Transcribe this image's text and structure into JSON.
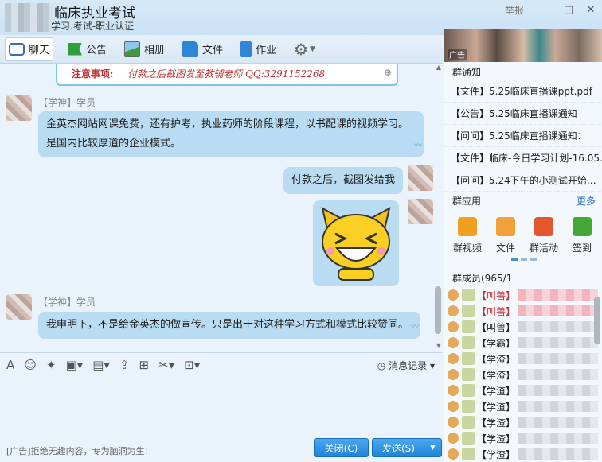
{
  "window": {
    "title": "临床执业考试",
    "subtitle": "学习.考试-职业认证",
    "report_label": "举报",
    "ctrl_min": "—",
    "ctrl_max": "□",
    "ctrl_close": "✕"
  },
  "toolbar": {
    "items": [
      {
        "label": "聊天"
      },
      {
        "label": "公告"
      },
      {
        "label": "相册"
      },
      {
        "label": "文件"
      },
      {
        "label": "作业"
      }
    ],
    "arrow": "▼"
  },
  "chat": {
    "notice_image": {
      "bold": "注意事项:",
      "text": "付款之后截图发至教辅老师 QQ:3291152268"
    },
    "messages": [
      {
        "sender": "【学神】学员",
        "line1": "金英杰网站网课免费，还有护考，执业药师的阶段课程，以书配课的视频学习。",
        "line2": "是国内比较厚道的企业模式。"
      },
      {
        "text": "付款之后，截图发给我"
      },
      {
        "sender": "【学神】学员",
        "text": "我申明下，不是给金英杰的做宣传。只是出于对这种学习方式和模式比较赞同。"
      }
    ]
  },
  "inputbar": {
    "history_label": "消息记录"
  },
  "footer": {
    "ad_text": "[广告]拒绝无趣内容，专为脑洞为生！",
    "close_label": "关闭(C)",
    "send_label": "发送(S)"
  },
  "side": {
    "ad_tag": "广告",
    "notice_head": "群通知",
    "notices": [
      "【文件】5.25临床直播课ppt.pdf",
      "【公告】5.25临床直播课通知",
      "【问问】5.25临床直播课通知：",
      "【文件】临床-今日学习计划-16.05.",
      "【问问】5.24下午的小测试开始了…"
    ],
    "apps_head": "群应用",
    "more_label": "更多",
    "apps": [
      {
        "label": "群视频",
        "color": "#f0a020"
      },
      {
        "label": "文件",
        "color": "#f2a03a"
      },
      {
        "label": "群活动",
        "color": "#e4572e"
      },
      {
        "label": "签到",
        "color": "#43a833"
      }
    ],
    "members_head": "群成员(965/1",
    "members": [
      {
        "role": "【叫兽】",
        "red": true
      },
      {
        "role": "【叫兽】",
        "red": true
      },
      {
        "role": "【叫兽】",
        "red": false
      },
      {
        "role": "【学霸】",
        "red": false
      },
      {
        "role": "【学渣】",
        "red": false
      },
      {
        "role": "【学渣】",
        "red": false
      },
      {
        "role": "【学渣】",
        "red": false
      },
      {
        "role": "【学渣】",
        "red": false
      },
      {
        "role": "【学渣】",
        "red": false
      },
      {
        "role": "【学渣】",
        "red": false
      },
      {
        "role": "【学渣】",
        "red": false
      },
      {
        "role": "【学渣】",
        "red": false
      }
    ]
  }
}
